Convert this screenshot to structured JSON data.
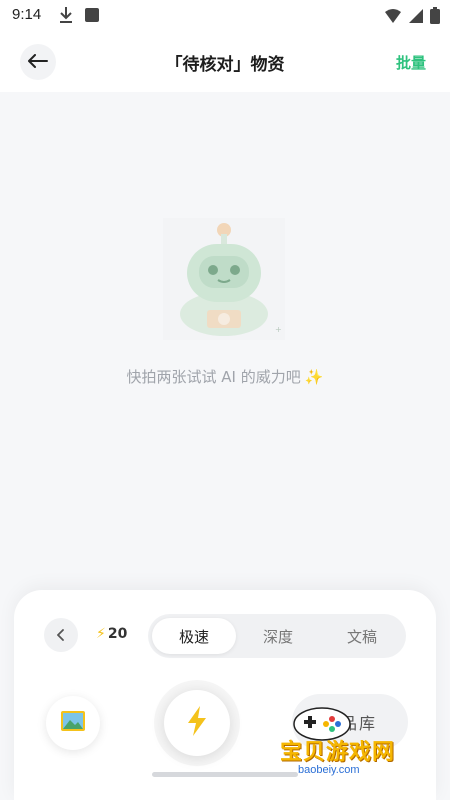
{
  "status_bar": {
    "time": "9:14"
  },
  "header": {
    "title": "「待核对」物资",
    "batch_label": "批量"
  },
  "empty_state": {
    "message": "快拍两张试试 AI 的威力吧",
    "sparkle": "✨"
  },
  "bottom_panel": {
    "credits": "20",
    "modes": [
      {
        "label": "极速",
        "active": true
      },
      {
        "label": "深度",
        "active": false
      },
      {
        "label": "文稿",
        "active": false
      }
    ],
    "library_label": "物品库"
  },
  "watermark": {
    "main": "宝贝游戏网",
    "sub": "baobeiy.com"
  },
  "colors": {
    "accent": "#2ec27e",
    "bolt": "#f4c21b",
    "background": "#f6f7f9"
  }
}
